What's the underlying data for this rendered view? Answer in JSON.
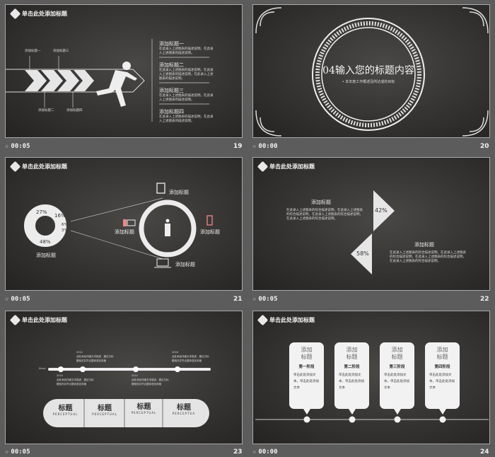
{
  "common": {
    "slide_title": "单击此处添加标题",
    "desc": "在此录入上述图表的综合描述说明，在此录入上述图表的综合描述说明。"
  },
  "slides": [
    {
      "number": "19",
      "time": "00:05",
      "labels": [
        "添加标题一",
        "添加标题二",
        "添加标题三",
        "添加标题四"
      ],
      "items": [
        {
          "title": "添加标题一",
          "body": "在此录入上述图表的描述说明，在此录入上述图表的描述说明。"
        },
        {
          "title": "添加标题二",
          "body": "在此录入上述图表的描述说明，在此录入上述图表的描述说明，在此录入上述图表的描述说明。"
        },
        {
          "title": "添加标题三",
          "body": "在此录入上述图表的描述说明，在此录入上述图表的描述说明。"
        },
        {
          "title": "添加标题四",
          "body": "在此录入上述图表的描述说明，在此录入上述图表的描述说明。"
        }
      ]
    },
    {
      "number": "20",
      "time": "00:00",
      "title": "04输入您的标题内容",
      "subtitle": "• 本年度工作概述及所达成的目标"
    },
    {
      "number": "21",
      "time": "00:05",
      "donut": [
        "27%",
        "16%",
        "6%",
        "3%",
        "48%"
      ],
      "donut_label": "添加标题",
      "icon_labels": [
        "添加标题",
        "添加标题",
        "添加标题",
        "添加标题"
      ]
    },
    {
      "number": "22",
      "time": "00:05",
      "blocks": [
        {
          "title": "添加标题",
          "pct": "42%",
          "body": "在此录入上述图表的综合描述说明，在此录入上述图表的综合描述说明，在此录入上述图表的综合描述说明，在此录入上述图表的综合描述说明。"
        },
        {
          "title": "添加标题",
          "pct": "58%",
          "body": "在此录入上述图表的综合描述说明，在此录入上述图表的综合描述说明，在此录入上述图表的综合描述说明，在此录入上述图表的综合描述说明。"
        }
      ]
    },
    {
      "number": "23",
      "time": "00:05",
      "since": "Since",
      "years": [
        "2012",
        "2016",
        "2010",
        "2014"
      ],
      "year_text": "此处添加详细文本描述，建议与标题相关并符合整体语言风格",
      "tabs": [
        {
          "t": "标题",
          "s": "PERCEPTUAL"
        },
        {
          "t": "标题",
          "s": "PERCEPTUAL"
        },
        {
          "t": "标题",
          "s": "PERCEPTUAL"
        },
        {
          "t": "标题",
          "s": "PERCEPTUA"
        }
      ]
    },
    {
      "number": "24",
      "time": "00:00",
      "cards": [
        {
          "t": "添加标题",
          "s": "第一阶段",
          "b": "单击此处添加文本，单击此处添加文本"
        },
        {
          "t": "添加标题",
          "s": "第二阶段",
          "b": "单击此处添加文本，单击此处添加文本"
        },
        {
          "t": "添加标题",
          "s": "第三阶段",
          "b": "单击此处添加文本，单击此处添加文本"
        },
        {
          "t": "添加标题",
          "s": "第四阶段",
          "b": "单击此处添加文本，单击此处添加文本"
        }
      ]
    }
  ]
}
